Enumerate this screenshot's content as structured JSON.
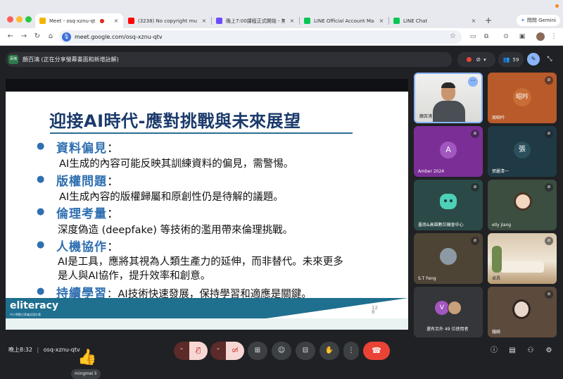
{
  "colors": {
    "accent": "#8ab4f8",
    "end_call": "#ea4335",
    "title_blue": "#1b3a6b",
    "heading_blue": "#2f6fb0"
  },
  "browser": {
    "tabs": [
      {
        "label": "Meet - osq-xznu-qtv",
        "icon": "meet-favicon",
        "active": true
      },
      {
        "label": "(3238) No copyright music -",
        "icon": "youtube-favicon"
      },
      {
        "label": "晚上7:00課程正式開始 - 無相",
        "icon": "app-favicon"
      },
      {
        "label": "LINE Official Account Manag",
        "icon": "line-favicon"
      },
      {
        "label": "LINE Chat",
        "icon": "line-favicon"
      }
    ],
    "new_tab": "+",
    "gemini_label": "問問 Gemini",
    "url": "meet.google.com/osq-xznu-qtv"
  },
  "meet": {
    "presenter_chip": "百鴻",
    "banner": "顏百鴻 (正在分享螢幕畫面和新增註解)",
    "participant_count": "59",
    "slide": {
      "title": "迎接AI時代-應對挑戰與未來展望",
      "sections": [
        {
          "heading": "資料偏見",
          "colon": "：",
          "lines": [
            "AI生成的內容可能反映其訓練資料的偏見，需警惕。"
          ]
        },
        {
          "heading": "版權問題",
          "colon": "：",
          "lines": [
            "AI生成內容的版權歸屬和原創性仍是待解的議題。"
          ]
        },
        {
          "heading": "倫理考量",
          "colon": "：",
          "lines": [
            "深度偽造 (deepfake) 等技術的濫用帶來倫理挑戰。"
          ]
        },
        {
          "heading": "人機協作",
          "colon": "：",
          "lines": [
            "AI是工具，應將其視為人類生產力的延伸，而非替代。未來更多",
            "是人與AI協作，提升效率和創意。"
          ]
        },
        {
          "heading": "持續學習",
          "colon": "：",
          "lines": [
            "AI技術快速發展，保持學習和適應是關鍵。"
          ]
        }
      ],
      "logo": "eliteracy",
      "logo_sub": "中小學數位素養認證計畫",
      "page_number": "12\n8"
    },
    "reaction": {
      "emoji": "👍",
      "name": "mingmei li"
    },
    "participants": [
      {
        "name": "顏百鴻",
        "type": "video"
      },
      {
        "name": "周昭吟",
        "initial": "昭吟",
        "bg": "#c5642e",
        "muted": true
      },
      {
        "name": "Amber 2024",
        "initial": "A",
        "bg": "#8e44ad",
        "muted": true
      },
      {
        "name": "張麗清一",
        "initial": "張",
        "bg": "#2c3e50",
        "muted": true
      },
      {
        "name": "臺南&高雄數位機會中心",
        "type": "logo",
        "muted": true
      },
      {
        "name": "elly jiang",
        "type": "avatar-img",
        "muted": true
      },
      {
        "name": "S.T Feng",
        "type": "photo",
        "muted": true
      },
      {
        "name": "貞昌",
        "type": "room",
        "muted": true
      },
      {
        "name": "還有另外 49 位使用者",
        "initial": "V",
        "type": "more"
      },
      {
        "name": "鐘綺",
        "type": "portrait",
        "muted": true
      }
    ],
    "clock": "晚上8:32",
    "meeting_code": "osq-xznu-qtv"
  }
}
